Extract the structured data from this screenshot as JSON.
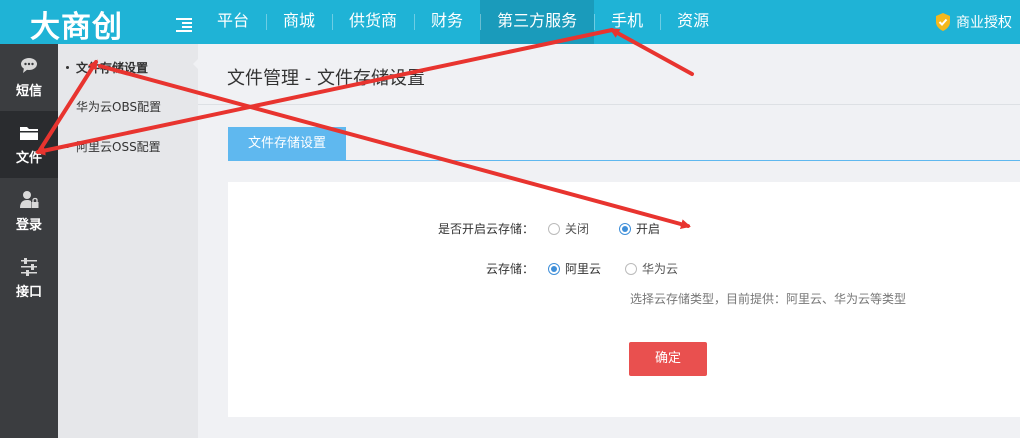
{
  "app": {
    "logo": "大商创",
    "license": "商业授权"
  },
  "nav": {
    "items": [
      {
        "label": "平台"
      },
      {
        "label": "商城"
      },
      {
        "label": "供货商"
      },
      {
        "label": "财务"
      },
      {
        "label": "第三方服务",
        "active": true
      },
      {
        "label": "手机"
      },
      {
        "label": "资源"
      }
    ]
  },
  "sidebar": {
    "items": [
      {
        "label": "短信",
        "icon": "chat-icon"
      },
      {
        "label": "文件",
        "icon": "folder-icon",
        "active": true
      },
      {
        "label": "登录",
        "icon": "user-lock-icon"
      },
      {
        "label": "接口",
        "icon": "sliders-icon"
      }
    ]
  },
  "submenu": {
    "items": [
      {
        "label": "文件存储设置",
        "active": true
      },
      {
        "label": "华为云OBS配置"
      },
      {
        "label": "阿里云OSS配置"
      }
    ]
  },
  "main": {
    "title": "文件管理 - 文件存储设置",
    "tab": "文件存储设置",
    "form": {
      "enable_label": "是否开启云存储：",
      "enable_off": "关闭",
      "enable_on": "开启",
      "storage_label": "云存储：",
      "storage_aliyun": "阿里云",
      "storage_huawei": "华为云",
      "hint": "选择云存储类型，目前提供：阿里云、华为云等类型",
      "submit": "确定"
    }
  },
  "colors": {
    "topbar": "#1fb3d6",
    "nav_active": "#1a9bbb",
    "sidebar": "#3b3d40",
    "tab": "#5fb8ef",
    "button": "#e9504f",
    "arrow": "#e8342f",
    "radio_checked": "#3f8fd9"
  }
}
